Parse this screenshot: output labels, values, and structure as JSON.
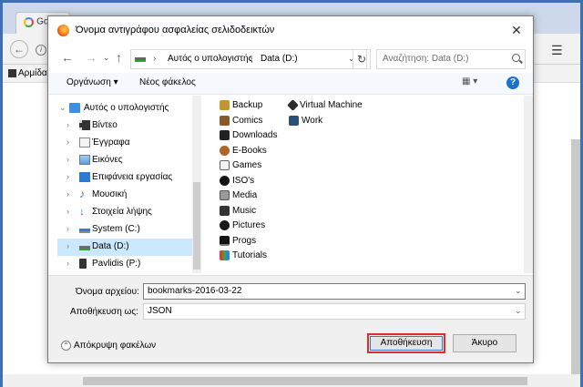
{
  "browser": {
    "tab_title": "Go",
    "bookmark_label": "Αρμίδα",
    "menu_glyph": "☰"
  },
  "dialog": {
    "title": "Όνομα αντιγράφου ασφαλείας σελιδοδεικτών",
    "close_glyph": "✕",
    "address": {
      "crumbs": [
        "Αυτός ο υπολογιστής",
        "Data (D:)"
      ]
    },
    "search_placeholder": "Αναζήτηση: Data (D:)",
    "toolbar": {
      "organize_label": "Οργάνωση ▾",
      "new_folder_label": "Νέος φάκελος",
      "help_glyph": "?"
    },
    "tree": [
      {
        "label": "Αυτός ο υπολογιστής",
        "icon": "computer-icon",
        "expanded": true
      },
      {
        "label": "Βίντεο",
        "icon": "video-folder-icon"
      },
      {
        "label": "Έγγραφα",
        "icon": "documents-folder-icon"
      },
      {
        "label": "Εικόνες",
        "icon": "pictures-folder-icon"
      },
      {
        "label": "Επιφάνεια εργασίας",
        "icon": "desktop-folder-icon"
      },
      {
        "label": "Μουσική",
        "icon": "music-folder-icon"
      },
      {
        "label": "Στοιχεία λήψης",
        "icon": "downloads-folder-icon"
      },
      {
        "label": "System (C:)",
        "icon": "system-drive-icon"
      },
      {
        "label": "Data (D:)",
        "icon": "data-drive-icon",
        "selected": true
      },
      {
        "label": "Pavlidis (P:)",
        "icon": "network-drive-icon"
      }
    ],
    "files_col1": [
      "Backup",
      "Comics",
      "Downloads",
      "E-Books",
      "Games",
      "ISO's",
      "Media",
      "Music",
      "Pictures",
      "Progs",
      "Tutorials"
    ],
    "files_col2": [
      "Virtual Machine",
      "Work"
    ],
    "filename_label": "Όνομα αρχείου:",
    "filename_value": "bookmarks-2016-03-22",
    "savetype_label": "Αποθήκευση ως:",
    "savetype_value": "JSON",
    "hide_folders_label": "Απόκρυψη φακέλων",
    "save_label": "Αποθήκευση",
    "cancel_label": "Άκυρο"
  },
  "colors": {
    "accent_border": "#3d6fb6",
    "selected_row": "#cce8ff",
    "save_highlight": "#e32b2b"
  }
}
